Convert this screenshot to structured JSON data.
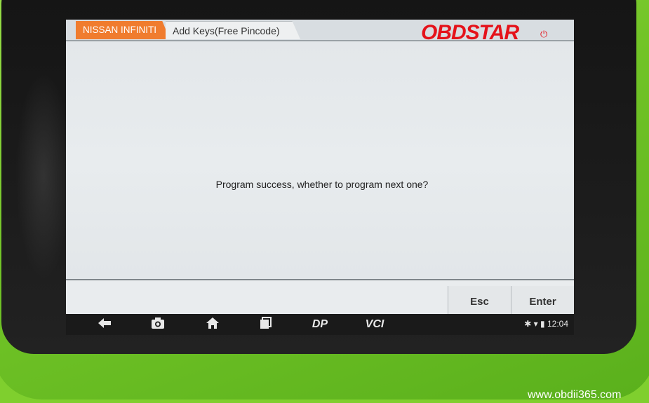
{
  "tabs": {
    "brand": "NISSAN INFINITI",
    "function": "Add Keys(Free Pincode)"
  },
  "logo": {
    "text": "OBDSTAR",
    "color": "#e5121a"
  },
  "dialog": {
    "message": "Program success,  whether to program next one?"
  },
  "buttons": {
    "esc": "Esc",
    "enter": "Enter"
  },
  "navbar": {
    "back_icon": "back-arrow-icon",
    "camera_icon": "camera-icon",
    "home_icon": "home-icon",
    "recent_icon": "recent-apps-icon",
    "dp_label": "DP",
    "vci_label": "VCI"
  },
  "status": {
    "time": "12:04"
  },
  "watermark": "www.obdii365.com",
  "colors": {
    "device_green": "#7fcf2e",
    "tab_orange": "#f07c2e"
  }
}
